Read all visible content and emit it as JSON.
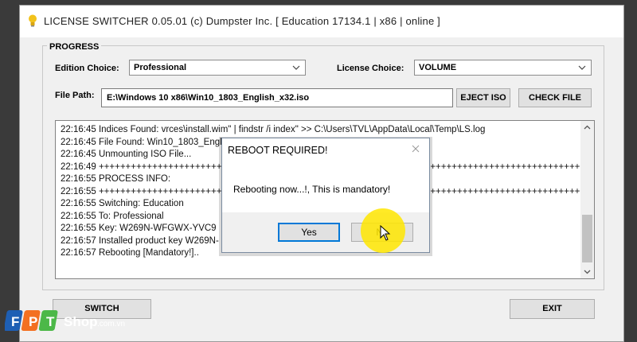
{
  "window": {
    "title": "LICENSE SWITCHER 0.05.01 (c) Dumpster Inc. [ Education 17134.1 | x86 | online ]"
  },
  "progress": {
    "group_label": "PROGRESS",
    "edition_label": "Edition Choice:",
    "edition_value": "Professional",
    "license_label": "License Choice:",
    "license_value": "VOLUME",
    "filepath_label": "File Path:",
    "filepath_value": "E:\\Windows 10 x86\\Win10_1803_English_x32.iso",
    "eject_label": "EJECT ISO",
    "check_label": "CHECK FILE"
  },
  "log": {
    "lines": [
      "22:16:45 Indices Found: vrces\\install.wim\" | findstr /i index\" >> C:\\Users\\TVL\\AppData\\Local\\Temp\\LS.log",
      "22:16:45 File Found: Win10_1803_Engl",
      "22:16:45 Unmounting ISO File...",
      "22:16:49 +++++++++++++++++++++++++++++++++++++++++++++++++++++++++++++++++++++++++++++++++++++++++++++++++++++++++++",
      "22:16:55 PROCESS INFO:",
      "22:16:55 +++++++++++++++++++++++++++++++++++++++++++++++++++++++++++++++++++++++++++++++++++++++++++++++++++++++++++",
      "22:16:55 Switching: Education",
      "22:16:55 To: Professional",
      "22:16:55 Key: W269N-WFGWX-YVC9",
      "22:16:57 Installed product key W269N-",
      "22:16:57 Rebooting [Mandatory!].."
    ]
  },
  "footer": {
    "switch_label": "SWITCH",
    "exit_label": "EXIT"
  },
  "dialog": {
    "title": "REBOOT REQUIRED!",
    "message": "Rebooting now...!, This is mandatory!",
    "yes_label": "Yes",
    "no_label": "No"
  },
  "watermark": {
    "brand_letters": "FPT",
    "shop_text": "Shop",
    "domain_text": ".com.vn"
  },
  "colors": {
    "accent_blue": "#0078d7",
    "highlight_yellow": "#ffe600",
    "fpt_blue": "#1e5fb4",
    "fpt_orange": "#f37021",
    "fpt_green": "#4cb848"
  }
}
